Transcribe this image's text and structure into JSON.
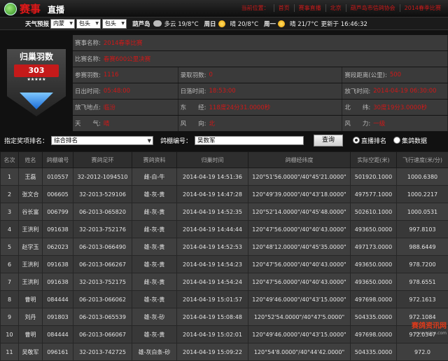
{
  "header": {
    "brand": "赛事",
    "brand_sub": "直播",
    "nav": [
      "当前位置：",
      "首页",
      "赛事直播",
      "北京",
      "葫芦岛市信鸽协会",
      "2014春季比赛"
    ]
  },
  "weather": {
    "label": "天气预报",
    "province": "内蒙",
    "city": "包头",
    "district": "包头",
    "place": "葫芦岛",
    "today_desc": "多云 19/8°C",
    "day1": "周日",
    "day1_desc": "晴 20/8°C",
    "day2": "周一",
    "day2_desc": "晴 21/7°C",
    "updated": "更新于 16:46:32"
  },
  "badge": {
    "title": "归巢羽数",
    "count": "303",
    "stars": "★★★★★"
  },
  "info": {
    "race_name_label": "赛事名称:",
    "race_name_value": "2014春季比赛",
    "event_name_label": "比赛名称:",
    "event_name_value": "春赛600公里决赛",
    "entries_label": "参赛羽数:",
    "entries_value": "1116",
    "recorded_label": "录取羽数:",
    "recorded_value": "0",
    "distance_label": "赛段距离(公里):",
    "distance_value": "500",
    "sunrise_label": "日出时间:",
    "sunrise_value": "05:48:00",
    "sunset_label": "日落时间:",
    "sunset_value": "18:53:00",
    "release_label": "放飞时间:",
    "release_value": "2014-04-19 06:30:00",
    "release_place_label": "放飞地点:",
    "release_place_value": "临汾",
    "east_label": "东　　经:",
    "east_value": "118度24分31.0000秒",
    "north_label": "北　　纬:",
    "north_value": "30度19分3.0000秒",
    "weather_label": "天　　气:",
    "weather_value": "晴",
    "wind_dir_label": "风　　向:",
    "wind_dir_value": "北",
    "wind_label": "风　　力:",
    "wind_value": "一级"
  },
  "filter": {
    "rank_label": "指定奖项排名：",
    "rank_value": "综合排名",
    "loft_label": "鸽棚编号：",
    "loft_value": "吴数军",
    "query_button": "查询",
    "radio_live": "直播排名",
    "radio_group": "集鸽数据"
  },
  "table": {
    "headers": [
      "名次",
      "姓名",
      "鸽棚编号",
      "赛鸽足环",
      "赛鸽资料",
      "归巢时间",
      "鸽棚经纬度",
      "实际空距(米)",
      "飞行速度(米/分)"
    ],
    "rows": [
      [
        "1",
        "王磊",
        "010557",
        "32-2012-1094510",
        "雌-白-牛",
        "2014-04-19 14:51:36",
        "120°51'56.0000\"/40°45'21.0000\"",
        "501920.1000",
        "1000.6380"
      ],
      [
        "2",
        "张文合",
        "006605",
        "32-2013-529106",
        "雄-灰-黄",
        "2014-04-19 14:47:28",
        "120°49'39.0000\"/40°43'18.0000\"",
        "497577.1000",
        "1000.2217"
      ],
      [
        "3",
        "谷长富",
        "006799",
        "06-2013-065820",
        "雌-灰-黄",
        "2014-04-19 14:52:35",
        "120°52'14.0000\"/40°45'48.0000\"",
        "502610.1000",
        "1000.0531"
      ],
      [
        "4",
        "王洪利",
        "091638",
        "32-2013-752176",
        "雌-灰-黄",
        "2014-04-19 14:44:44",
        "120°47'56.0000\"/40°40'43.0000\"",
        "493650.0000",
        "997.8103"
      ],
      [
        "5",
        "赵学玉",
        "062023",
        "06-2013-066490",
        "雄-灰-黄",
        "2014-04-19 14:52:53",
        "120°48'12.0000\"/40°45'35.0000\"",
        "497173.0000",
        "988.6449"
      ],
      [
        "6",
        "王洪利",
        "091638",
        "06-2013-066267",
        "雄-灰-黄",
        "2014-04-19 14:54:23",
        "120°47'56.0000\"/40°40'43.0000\"",
        "493650.0000",
        "978.7200"
      ],
      [
        "7",
        "王洪利",
        "091638",
        "32-2013-752175",
        "雌-灰-黄",
        "2014-04-19 14:54:24",
        "120°47'56.0000\"/40°40'43.0000\"",
        "493650.0000",
        "978.6551"
      ],
      [
        "8",
        "曹明",
        "084444",
        "06-2013-066062",
        "雄-灰-黄",
        "2014-04-19 15:01:57",
        "120°49'46.0000\"/40°43'15.0000\"",
        "497698.0000",
        "972.1613"
      ],
      [
        "9",
        "刘丹",
        "091803",
        "06-2013-065539",
        "雄-灰-砂",
        "2014-04-19 15:08:48",
        "120°52'54.0000\"/40°47'5.0000\"",
        "504335.0000",
        "972.1084"
      ],
      [
        "10",
        "曹明",
        "084444",
        "06-2013-066067",
        "雄-灰-黄",
        "2014-04-19 15:02:01",
        "120°49'46.0000\"/40°43'15.0000\"",
        "497698.0000",
        "972.0347"
      ],
      [
        "11",
        "吴敬军",
        "096161",
        "32-2013-742725",
        "雄-灰白条-砂",
        "2014-04-19 15:09:22",
        "120°54'8.0000\"/40°44'42.0000\"",
        "504335.0000",
        "972.0"
      ]
    ]
  },
  "watermark": {
    "line1": "赛鸽资讯网",
    "line2": "www.saige.com"
  }
}
